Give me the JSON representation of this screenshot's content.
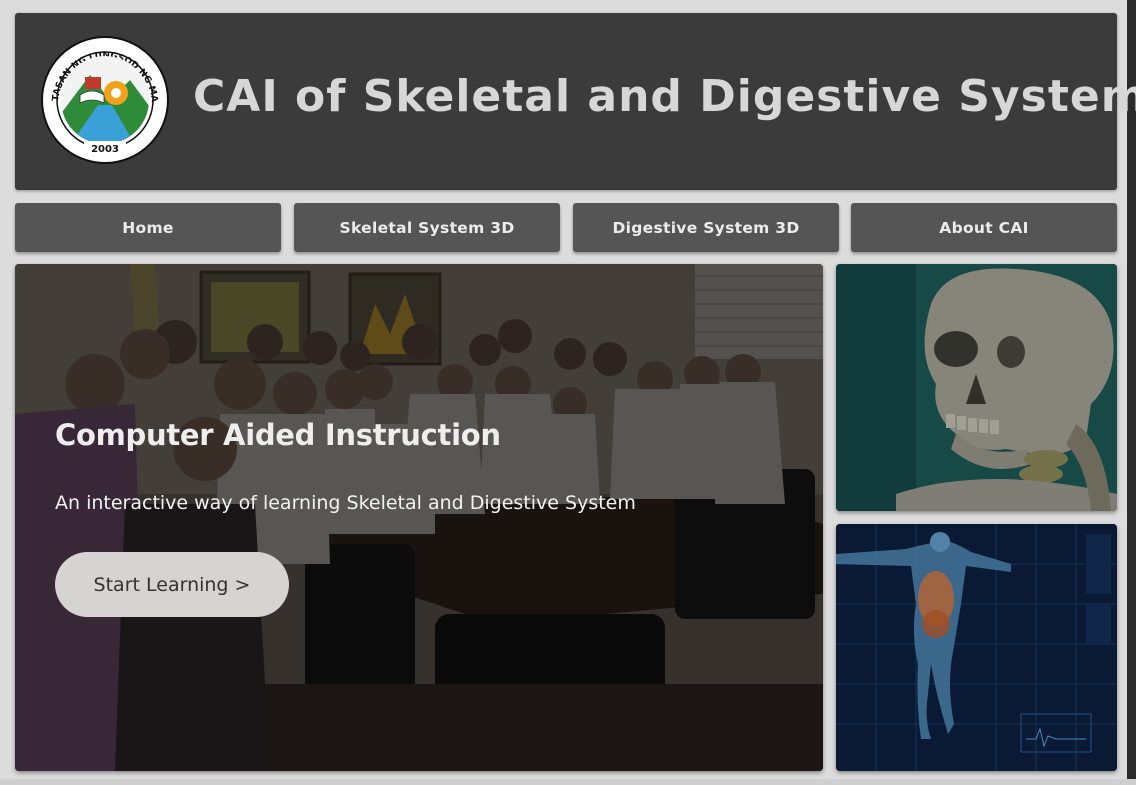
{
  "header": {
    "title": "CAI of Skeletal and Digestive System",
    "logo": {
      "top_text": "PAMANTASAN NG LUNGSOD NG MARIKINA",
      "year": "2003"
    }
  },
  "nav": {
    "items": [
      {
        "label": "Home"
      },
      {
        "label": "Skeletal System 3D"
      },
      {
        "label": "Digestive System 3D"
      },
      {
        "label": "About CAI"
      }
    ]
  },
  "hero": {
    "title": "Computer Aided Instruction",
    "subtitle": "An interactive way of learning Skeletal and Digestive System",
    "button_label": "Start Learning >"
  },
  "colors": {
    "page_bg": "#dcdcdc",
    "header_bg": "#3b3b3b",
    "nav_bg": "#555555",
    "title_text": "#d7d7d7",
    "button_bg": "#d6d3d3"
  }
}
